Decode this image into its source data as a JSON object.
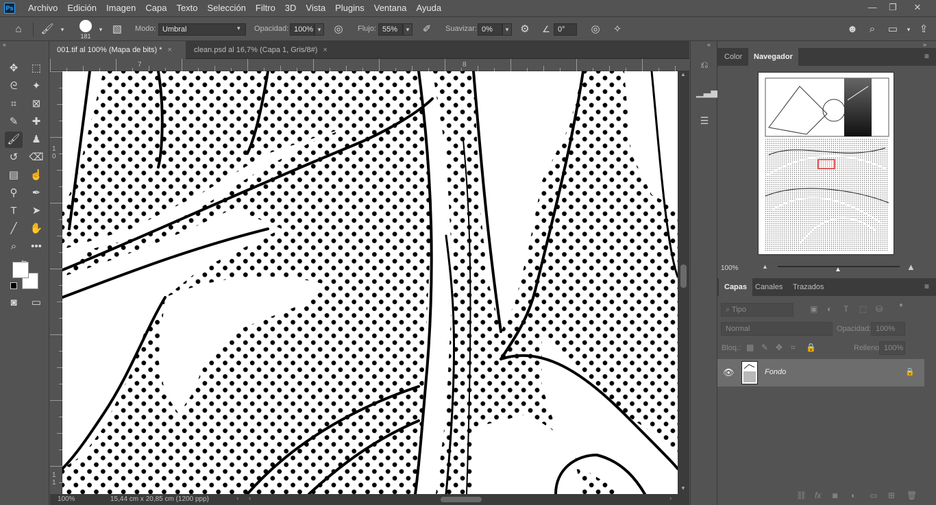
{
  "menubar": {
    "logo": "Ps",
    "items": [
      "Archivo",
      "Edición",
      "Imagen",
      "Capa",
      "Texto",
      "Selección",
      "Filtro",
      "3D",
      "Vista",
      "Plugins",
      "Ventana",
      "Ayuda"
    ],
    "minimize": "—",
    "restore": "❐",
    "close": "✕"
  },
  "options": {
    "brush_size": "181",
    "mode_label": "Modo:",
    "mode_value": "Umbral",
    "opacity_label": "Opacidad:",
    "opacity_value": "100%",
    "flow_label": "Flujo:",
    "flow_value": "55%",
    "smooth_label": "Suavizar:",
    "smooth_value": "0%",
    "angle_value": "0°"
  },
  "doc_tabs": [
    {
      "label": "001.tif al 100% (Mapa de bits) *",
      "close": "×"
    },
    {
      "label": "clean.psd al 16,7% (Capa 1, Gris/8#)",
      "close": "×"
    }
  ],
  "rulers": {
    "top": [
      "7",
      "8"
    ],
    "left": [
      "1\n0",
      "1\n1"
    ]
  },
  "status": {
    "zoom": "100%",
    "doc_size": "15,44 cm x 20,85 cm (1200 ppp)"
  },
  "panels": {
    "top_tabs": [
      "Color",
      "Navegador"
    ],
    "navigator_zoom": "100%",
    "layer_tabs": [
      "Capas",
      "Canales",
      "Trazados"
    ],
    "layer_filter": "Tipo",
    "blend_mode": "Normal",
    "opacity_label": "Opacidad:",
    "opacity_value": "100%",
    "lock_label": "Bloq.:",
    "fill_label": "Relleno:",
    "fill_value": "100%",
    "layers": [
      {
        "name": "Fondo"
      }
    ]
  },
  "colors": {
    "ui_bg": "#535353",
    "ui_dark": "#3b3b3b",
    "accent_blue": "#31a8ff",
    "navigator_box": "#e03030"
  }
}
